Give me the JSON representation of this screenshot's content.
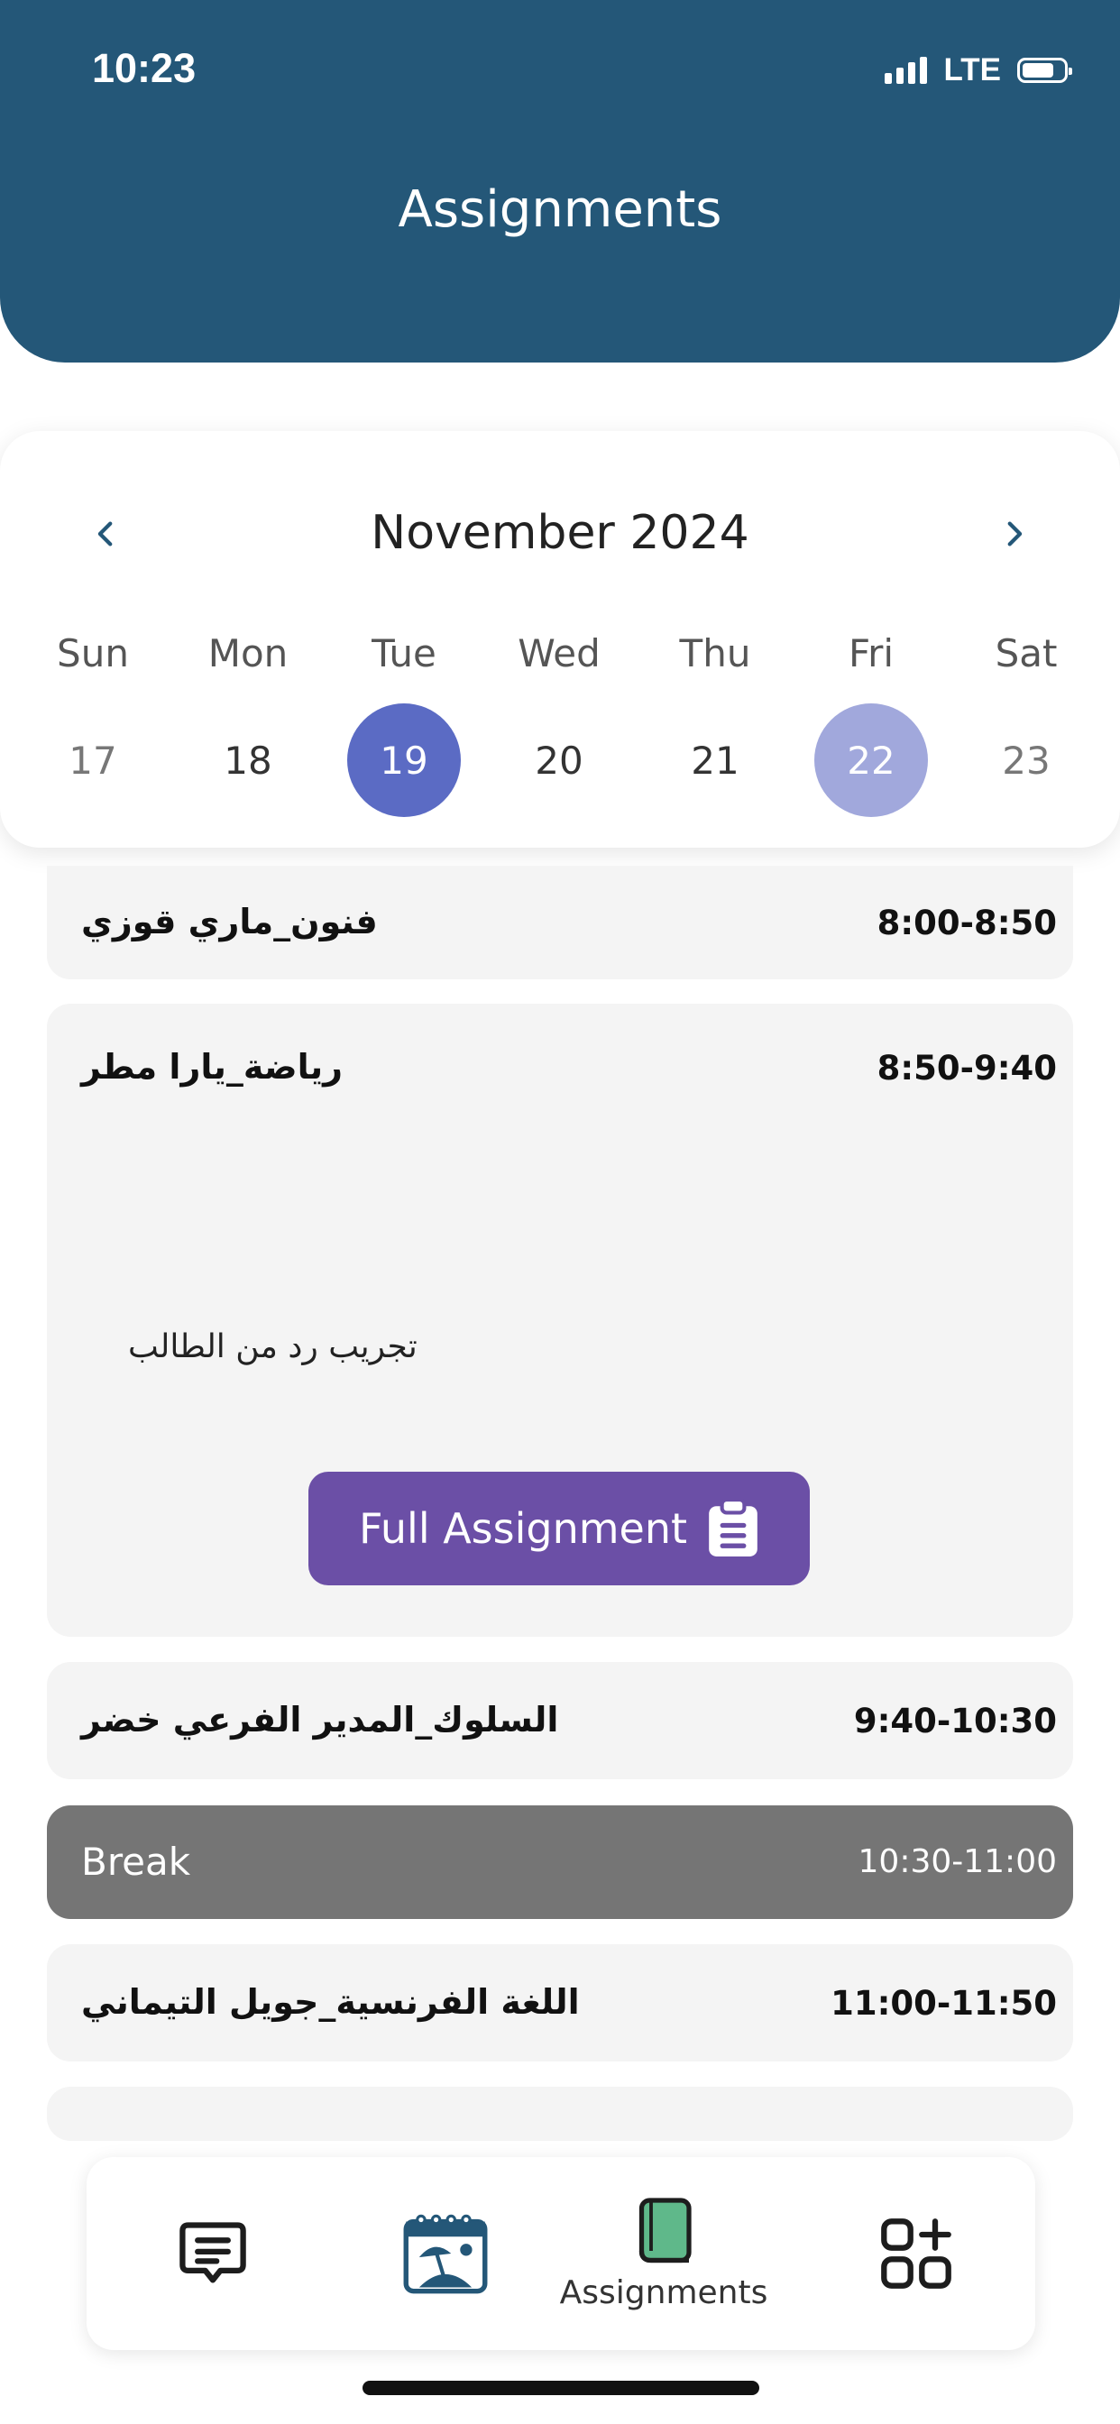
{
  "status_bar": {
    "time": "10:23",
    "network": "LTE"
  },
  "header": {
    "title": "Assignments"
  },
  "calendar": {
    "month": "November 2024",
    "days": [
      {
        "name": "Sun",
        "date": "17"
      },
      {
        "name": "Mon",
        "date": "18"
      },
      {
        "name": "Tue",
        "date": "19"
      },
      {
        "name": "Wed",
        "date": "20"
      },
      {
        "name": "Thu",
        "date": "21"
      },
      {
        "name": "Fri",
        "date": "22"
      },
      {
        "name": "Sat",
        "date": "23"
      }
    ],
    "selected_date": "19",
    "highlighted_date": "22",
    "selected_color": "#5b6bc4",
    "highlight_color": "#a1a8dc"
  },
  "schedule": [
    {
      "subject": "فنون_ماري قوزي",
      "time": "8:00-8:50"
    },
    {
      "subject": "رياضة_يارا مطر",
      "time": "8:50-9:40",
      "reply": "تجريب رد من الطالب",
      "button": "Full Assignment"
    },
    {
      "subject": "السلوك_المدير الفرعي خضر",
      "time": "9:40-10:30"
    },
    {
      "subject": "Break",
      "time": "10:30-11:00"
    },
    {
      "subject": "اللغة الفرنسية_جويل التيماني",
      "time": "11:00-11:50"
    }
  ],
  "bottom_nav": {
    "items": [
      {
        "icon": "message-icon"
      },
      {
        "icon": "vacation-calendar-icon"
      },
      {
        "icon": "book-icon",
        "label": "Assignments",
        "active": true
      },
      {
        "icon": "apps-add-icon"
      }
    ]
  },
  "colors": {
    "header": "#245778",
    "button": "#6b4fa6",
    "break": "#757575",
    "active_icon": "#5fb88a"
  }
}
